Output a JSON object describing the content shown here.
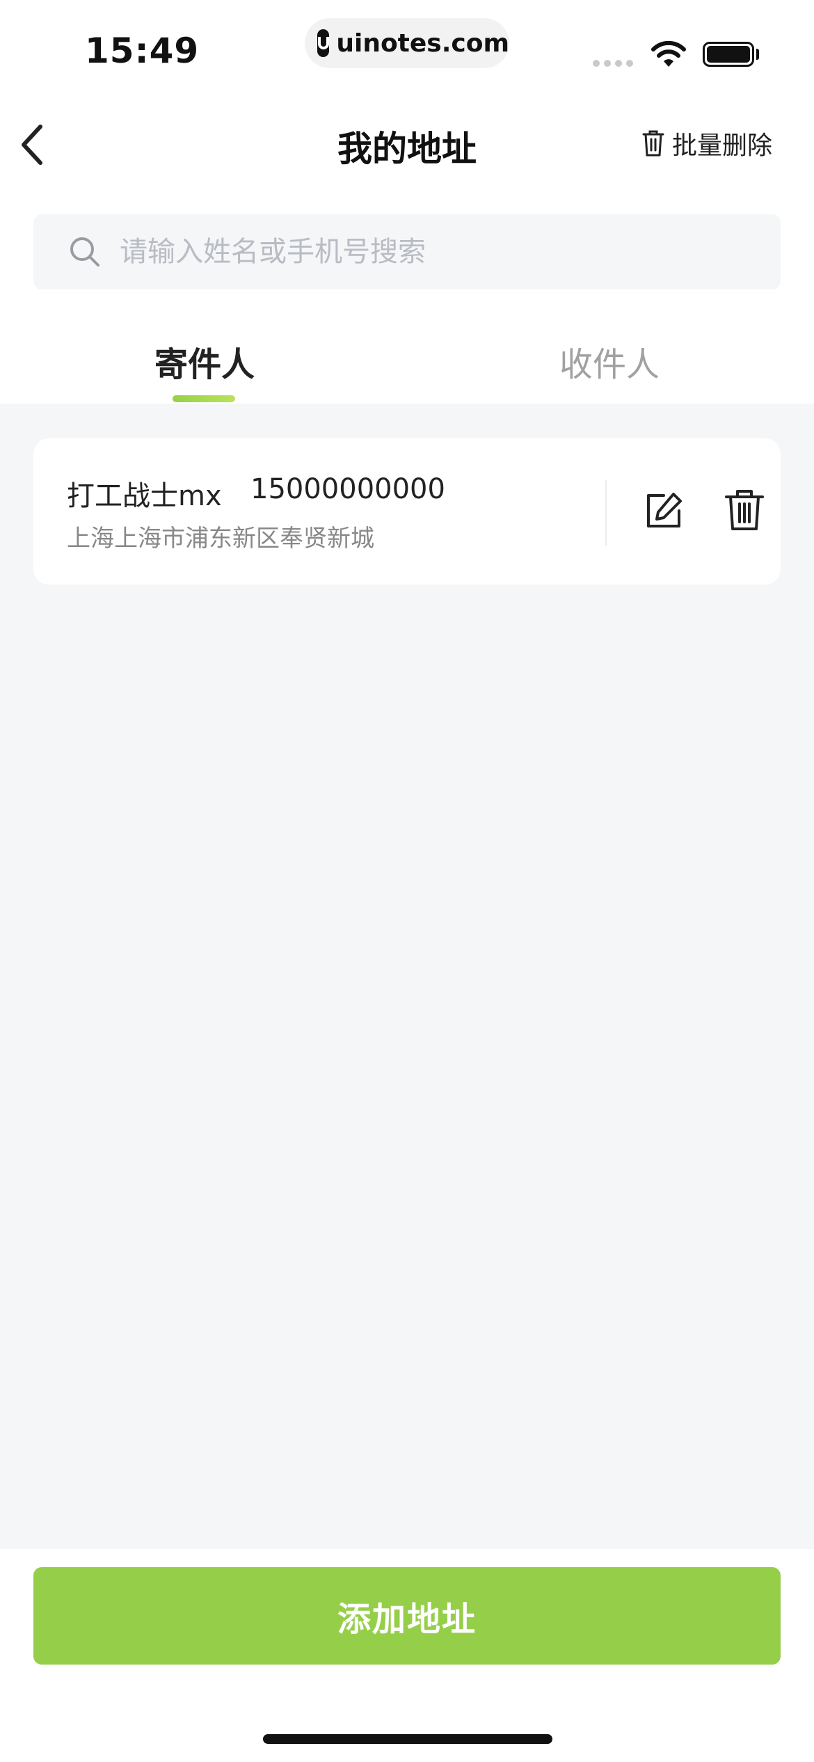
{
  "status_bar": {
    "time": "15:49",
    "url": "uinotes.com"
  },
  "nav": {
    "title": "我的地址",
    "batch_delete_label": "批量删除"
  },
  "search": {
    "placeholder": "请输入姓名或手机号搜索"
  },
  "tabs": [
    {
      "label": "寄件人",
      "active": true
    },
    {
      "label": "收件人",
      "active": false
    }
  ],
  "addresses": [
    {
      "name": "打工战士mx",
      "phone": "15000000000",
      "address": "上海上海市浦东新区奉贤新城"
    }
  ],
  "footer": {
    "add_button_label": "添加地址"
  },
  "colors": {
    "accent": "#95cf49",
    "background": "#f5f6f8",
    "active_tab_text": "#222222",
    "inactive_tab_text": "#a1a1a1"
  },
  "icons": [
    "back-arrow-icon",
    "trash-icon",
    "search-icon",
    "edit-icon",
    "delete-icon",
    "wifi-icon",
    "battery-icon",
    "signal-icon"
  ]
}
